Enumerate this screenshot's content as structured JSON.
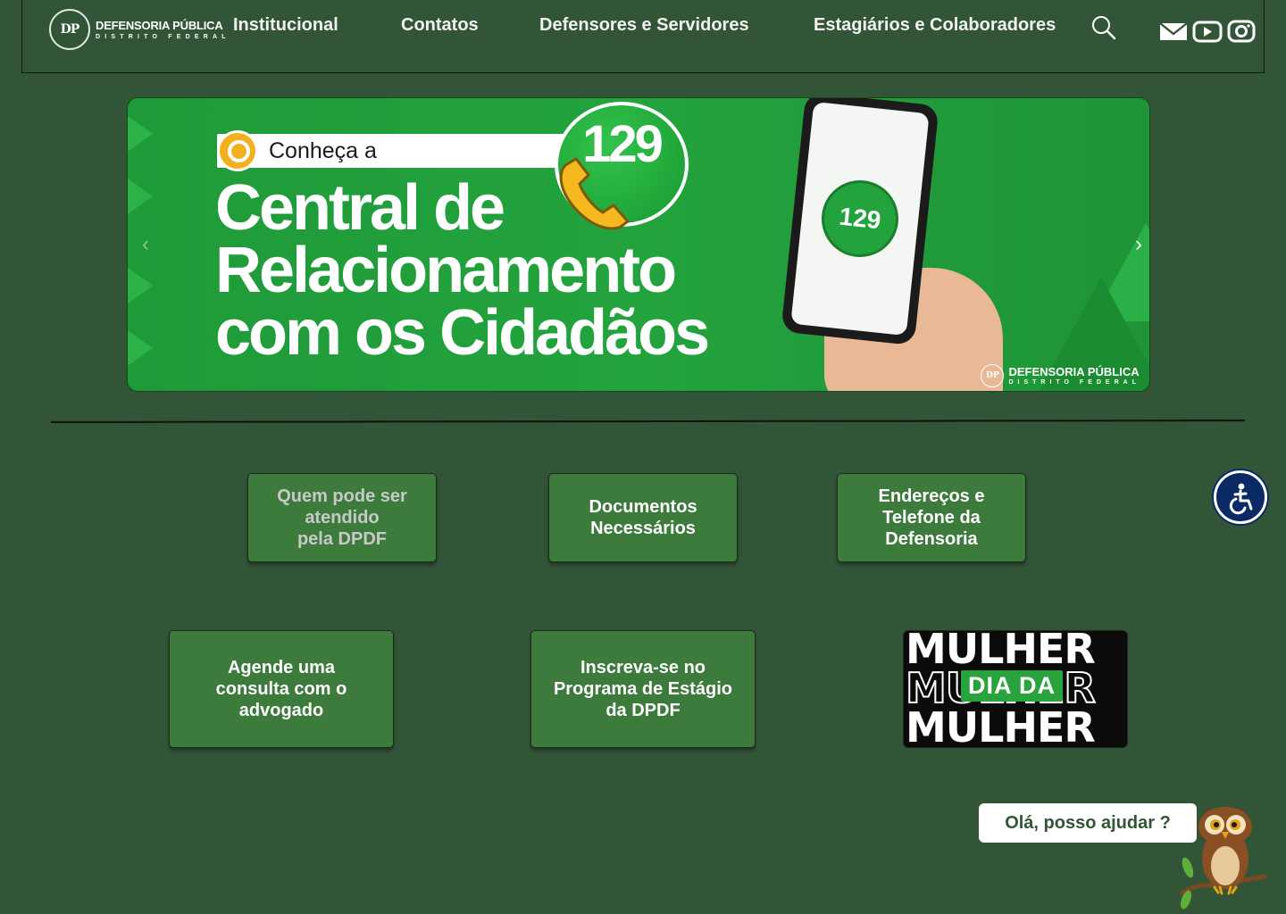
{
  "header": {
    "logo": {
      "seal": "DP",
      "name": "DEFENSORIA PÚBLICA",
      "sub": "DISTRITO FEDERAL"
    },
    "nav": [
      {
        "label": "Institucional"
      },
      {
        "label": "Contatos"
      },
      {
        "label": "Defensores e Servidores"
      },
      {
        "label": "Estagiários e Colaboradores"
      }
    ],
    "icons": [
      "search-icon",
      "mail-icon",
      "youtube-icon",
      "instagram-icon"
    ]
  },
  "banner": {
    "tag": "Conheça a",
    "title_lines": [
      "Central de",
      "Relacionamento",
      "com os Cidadãos"
    ],
    "badge": "129",
    "phone_badge": "129",
    "logo_name": "DEFENSORIA PÚBLICA",
    "logo_sub": "DISTRITO FEDERAL",
    "logo_seal": "DP",
    "prev": "‹",
    "next": "›"
  },
  "tiles": [
    {
      "label": "Quem pode ser\natendido\npela DPDF"
    },
    {
      "label": "Documentos\nNecessários"
    },
    {
      "label": "Endereços e\nTelefone da\nDefensoria"
    },
    {
      "label": "Agende uma\nconsulta com o\nadvogado"
    },
    {
      "label": "Inscreva-se no\nPrograma de Estágio\nda DPDF"
    }
  ],
  "promo": {
    "word": "MULHER",
    "badge": "DIA DA"
  },
  "chat": {
    "label": "Olá, posso ajudar ?"
  },
  "colors": {
    "background": "#325437",
    "tile": "#3c7b3b",
    "banner": "#23a33e",
    "accessibility": "#0a2a66"
  }
}
